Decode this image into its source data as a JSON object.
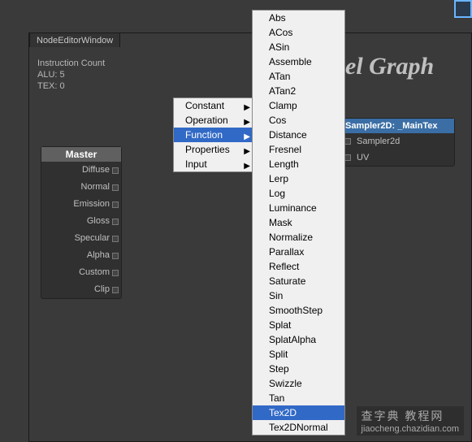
{
  "top_button": {
    "name": "external-button"
  },
  "tab_title": "NodeEditorWindow",
  "stats": {
    "line1": "Instruction Count",
    "line2": "ALU: 5",
    "line3": "TEX: 0"
  },
  "graph_title": "xel Graph",
  "master_node": {
    "title": "Master",
    "rows": [
      "Diffuse",
      "Normal",
      "Emission",
      "Gloss",
      "Specular",
      "Alpha",
      "Custom",
      "Clip"
    ]
  },
  "sampler_node": {
    "title": "Sampler2D: _MainTex",
    "rows": [
      "Sampler2d",
      "UV"
    ]
  },
  "menu1": {
    "items": [
      "Constant",
      "Operation",
      "Function",
      "Properties",
      "Input"
    ],
    "selected": "Function"
  },
  "menu2": {
    "items": [
      "Abs",
      "ACos",
      "ASin",
      "Assemble",
      "ATan",
      "ATan2",
      "Clamp",
      "Cos",
      "Distance",
      "Fresnel",
      "Length",
      "Lerp",
      "Log",
      "Luminance",
      "Mask",
      "Normalize",
      "Parallax",
      "Reflect",
      "Saturate",
      "Sin",
      "SmoothStep",
      "Splat",
      "SplatAlpha",
      "Split",
      "Step",
      "Swizzle",
      "Tan",
      "Tex2D",
      "Tex2DNormal"
    ],
    "selected": "Tex2D"
  },
  "watermark": {
    "line1": "查字典 教程网",
    "line2": "jiaocheng.chazidian.com"
  }
}
